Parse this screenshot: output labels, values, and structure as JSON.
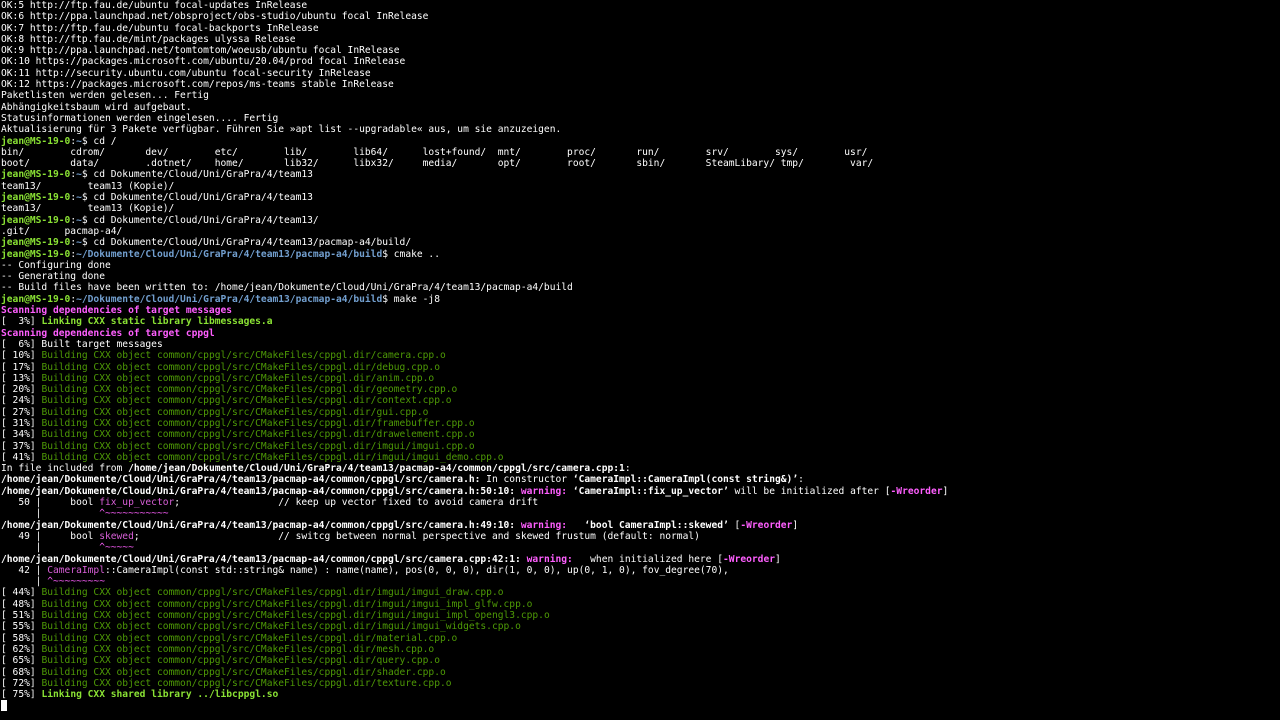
{
  "terminal": {
    "lines": [
      [
        {
          "t": "OK:5 http://ftp.fau.de/ubuntu focal-updates InRelease",
          "c": ""
        }
      ],
      [
        {
          "t": "OK:6 http://ppa.launchpad.net/obsproject/obs-studio/ubuntu focal InRelease",
          "c": ""
        }
      ],
      [
        {
          "t": "OK:7 http://ftp.fau.de/ubuntu focal-backports InRelease",
          "c": ""
        }
      ],
      [
        {
          "t": "OK:8 http://ftp.fau.de/mint/packages ulyssa Release",
          "c": ""
        }
      ],
      [
        {
          "t": "OK:9 http://ppa.launchpad.net/tomtomtom/woeusb/ubuntu focal InRelease",
          "c": ""
        }
      ],
      [
        {
          "t": "OK:10 https://packages.microsoft.com/ubuntu/20.04/prod focal InRelease",
          "c": ""
        }
      ],
      [
        {
          "t": "OK:11 http://security.ubuntu.com/ubuntu focal-security InRelease",
          "c": ""
        }
      ],
      [
        {
          "t": "OK:12 https://packages.microsoft.com/repos/ms-teams stable InRelease",
          "c": ""
        }
      ],
      [
        {
          "t": "Paketlisten werden gelesen... Fertig",
          "c": ""
        }
      ],
      [
        {
          "t": "Abhängigkeitsbaum wird aufgebaut.",
          "c": ""
        }
      ],
      [
        {
          "t": "Statusinformationen werden eingelesen.... Fertig",
          "c": ""
        }
      ],
      [
        {
          "t": "Aktualisierung für 3 Pakete verfügbar. Führen Sie »apt list --upgradable« aus, um sie anzuzeigen.",
          "c": ""
        }
      ],
      [
        {
          "t": "jean@MS-19-0",
          "c": "p-green"
        },
        {
          "t": ":",
          "c": ""
        },
        {
          "t": "~",
          "c": "p-blue"
        },
        {
          "t": "$ cd /",
          "c": ""
        }
      ],
      [
        {
          "t": "bin/        cdrom/       dev/        etc/        lib/        lib64/      lost+found/  mnt/        proc/       run/        srv/        sys/        usr/",
          "c": ""
        }
      ],
      [
        {
          "t": "boot/       data/        .dotnet/    home/       lib32/      libx32/     media/       opt/        root/       sbin/       SteamLibary/ tmp/        var/",
          "c": ""
        }
      ],
      [
        {
          "t": "jean@MS-19-0",
          "c": "p-green"
        },
        {
          "t": ":",
          "c": ""
        },
        {
          "t": "~",
          "c": "p-blue"
        },
        {
          "t": "$ cd Dokumente/Cloud/Uni/GraPra/4/team13",
          "c": ""
        }
      ],
      [
        {
          "t": "team13/        team13 (Kopie)/",
          "c": ""
        }
      ],
      [
        {
          "t": "jean@MS-19-0",
          "c": "p-green"
        },
        {
          "t": ":",
          "c": ""
        },
        {
          "t": "~",
          "c": "p-blue"
        },
        {
          "t": "$ cd Dokumente/Cloud/Uni/GraPra/4/team13",
          "c": ""
        }
      ],
      [
        {
          "t": "team13/        team13 (Kopie)/",
          "c": ""
        }
      ],
      [
        {
          "t": "jean@MS-19-0",
          "c": "p-green"
        },
        {
          "t": ":",
          "c": ""
        },
        {
          "t": "~",
          "c": "p-blue"
        },
        {
          "t": "$ cd Dokumente/Cloud/Uni/GraPra/4/team13/",
          "c": ""
        }
      ],
      [
        {
          "t": ".git/      pacmap-a4/",
          "c": ""
        }
      ],
      [
        {
          "t": "jean@MS-19-0",
          "c": "p-green"
        },
        {
          "t": ":",
          "c": ""
        },
        {
          "t": "~",
          "c": "p-blue"
        },
        {
          "t": "$ cd Dokumente/Cloud/Uni/GraPra/4/team13/pacmap-a4/build/",
          "c": ""
        }
      ],
      [
        {
          "t": "jean@MS-19-0",
          "c": "p-green"
        },
        {
          "t": ":",
          "c": ""
        },
        {
          "t": "~/Dokumente/Cloud/Uni/GraPra/4/team13/pacmap-a4/build",
          "c": "p-blue"
        },
        {
          "t": "$ cmake ..",
          "c": ""
        }
      ],
      [
        {
          "t": "-- Configuring done",
          "c": ""
        }
      ],
      [
        {
          "t": "-- Generating done",
          "c": ""
        }
      ],
      [
        {
          "t": "-- Build files have been written to: /home/jean/Dokumente/Cloud/Uni/GraPra/4/team13/pacmap-a4/build",
          "c": ""
        }
      ],
      [
        {
          "t": "jean@MS-19-0",
          "c": "p-green"
        },
        {
          "t": ":",
          "c": ""
        },
        {
          "t": "~/Dokumente/Cloud/Uni/GraPra/4/team13/pacmap-a4/build",
          "c": "p-blue"
        },
        {
          "t": "$ make -j8",
          "c": ""
        }
      ],
      [
        {
          "t": "Scanning dependencies of target messages",
          "c": "c-magenta"
        }
      ],
      [
        {
          "t": "[  3%] ",
          "c": ""
        },
        {
          "t": "Linking CXX static library libmessages.a",
          "c": "c-bgreen"
        }
      ],
      [
        {
          "t": "Scanning dependencies of target cppgl",
          "c": "c-magenta"
        }
      ],
      [
        {
          "t": "[  6%] Built target messages",
          "c": ""
        }
      ],
      [
        {
          "t": "[ 10%] ",
          "c": ""
        },
        {
          "t": "Building CXX object common/cppgl/src/CMakeFiles/cppgl.dir/camera.cpp.o",
          "c": "c-green"
        }
      ],
      [
        {
          "t": "[ 17%] ",
          "c": ""
        },
        {
          "t": "Building CXX object common/cppgl/src/CMakeFiles/cppgl.dir/debug.cpp.o",
          "c": "c-green"
        }
      ],
      [
        {
          "t": "[ 13%] ",
          "c": ""
        },
        {
          "t": "Building CXX object common/cppgl/src/CMakeFiles/cppgl.dir/anim.cpp.o",
          "c": "c-green"
        }
      ],
      [
        {
          "t": "[ 20%] ",
          "c": ""
        },
        {
          "t": "Building CXX object common/cppgl/src/CMakeFiles/cppgl.dir/geometry.cpp.o",
          "c": "c-green"
        }
      ],
      [
        {
          "t": "[ 24%] ",
          "c": ""
        },
        {
          "t": "Building CXX object common/cppgl/src/CMakeFiles/cppgl.dir/context.cpp.o",
          "c": "c-green"
        }
      ],
      [
        {
          "t": "[ 27%] ",
          "c": ""
        },
        {
          "t": "Building CXX object common/cppgl/src/CMakeFiles/cppgl.dir/gui.cpp.o",
          "c": "c-green"
        }
      ],
      [
        {
          "t": "[ 31%] ",
          "c": ""
        },
        {
          "t": "Building CXX object common/cppgl/src/CMakeFiles/cppgl.dir/framebuffer.cpp.o",
          "c": "c-green"
        }
      ],
      [
        {
          "t": "[ 34%] ",
          "c": ""
        },
        {
          "t": "Building CXX object common/cppgl/src/CMakeFiles/cppgl.dir/drawelement.cpp.o",
          "c": "c-green"
        }
      ],
      [
        {
          "t": "[ 37%] ",
          "c": ""
        },
        {
          "t": "Building CXX object common/cppgl/src/CMakeFiles/cppgl.dir/imgui/imgui.cpp.o",
          "c": "c-green"
        }
      ],
      [
        {
          "t": "[ 41%] ",
          "c": ""
        },
        {
          "t": "Building CXX object common/cppgl/src/CMakeFiles/cppgl.dir/imgui/imgui_demo.cpp.o",
          "c": "c-green"
        }
      ],
      [
        {
          "t": "In file included from ",
          "c": ""
        },
        {
          "t": "/home/jean/Dokumente/Cloud/Uni/GraPra/4/team13/pacmap-a4/common/cppgl/src/camera.cpp:1",
          "c": "c-white-b"
        },
        {
          "t": ":",
          "c": ""
        }
      ],
      [
        {
          "t": "/home/jean/Dokumente/Cloud/Uni/GraPra/4/team13/pacmap-a4/common/cppgl/src/camera.h:",
          "c": "c-white-b"
        },
        {
          "t": " In constructor ",
          "c": ""
        },
        {
          "t": "‘CameraImpl::CameraImpl(const string&)’",
          "c": "c-white-b"
        },
        {
          "t": ":",
          "c": ""
        }
      ],
      [
        {
          "t": "/home/jean/Dokumente/Cloud/Uni/GraPra/4/team13/pacmap-a4/common/cppgl/src/camera.h:50:10:",
          "c": "c-white-b"
        },
        {
          "t": " warning: ",
          "c": "c-bmag"
        },
        {
          "t": "‘CameraImpl::fix_up_vector’",
          "c": "c-white-b"
        },
        {
          "t": " will be initialized after [",
          "c": ""
        },
        {
          "t": "-Wreorder",
          "c": "c-bmag"
        },
        {
          "t": "]",
          "c": ""
        }
      ],
      [
        {
          "t": "   50 |     bool ",
          "c": ""
        },
        {
          "t": "fix_up_vector",
          "c": "c-magenta-n"
        },
        {
          "t": ";                 // keep up vector fixed to avoid camera drift",
          "c": ""
        }
      ],
      [
        {
          "t": "      |          ",
          "c": ""
        },
        {
          "t": "^~~~~~~~~~~~",
          "c": "c-caret"
        }
      ],
      [
        {
          "t": "/home/jean/Dokumente/Cloud/Uni/GraPra/4/team13/pacmap-a4/common/cppgl/src/camera.h:49:10:",
          "c": "c-white-b"
        },
        {
          "t": " warning: ",
          "c": "c-bmag"
        },
        {
          "t": "  ‘bool CameraImpl::skewed’",
          "c": "c-white-b"
        },
        {
          "t": " [",
          "c": ""
        },
        {
          "t": "-Wreorder",
          "c": "c-bmag"
        },
        {
          "t": "]",
          "c": ""
        }
      ],
      [
        {
          "t": "   49 |     bool ",
          "c": ""
        },
        {
          "t": "skewed",
          "c": "c-magenta-n"
        },
        {
          "t": ";                        // switcg between normal perspective and skewed frustum (default: normal)",
          "c": ""
        }
      ],
      [
        {
          "t": "      |          ",
          "c": ""
        },
        {
          "t": "^~~~~~",
          "c": "c-caret"
        }
      ],
      [
        {
          "t": "/home/jean/Dokumente/Cloud/Uni/GraPra/4/team13/pacmap-a4/common/cppgl/src/camera.cpp:42:1:",
          "c": "c-white-b"
        },
        {
          "t": " warning: ",
          "c": "c-bmag"
        },
        {
          "t": "  when initialized here [",
          "c": ""
        },
        {
          "t": "-Wreorder",
          "c": "c-bmag"
        },
        {
          "t": "]",
          "c": ""
        }
      ],
      [
        {
          "t": "   42 | ",
          "c": ""
        },
        {
          "t": "CameraImpl",
          "c": "c-magenta-n"
        },
        {
          "t": "::CameraImpl(const std::string& name) : name(name), pos(0, 0, 0), dir(1, 0, 0), up(0, 1, 0), fov_degree(70),",
          "c": ""
        }
      ],
      [
        {
          "t": "      | ",
          "c": ""
        },
        {
          "t": "^~~~~~~~~~",
          "c": "c-caret"
        }
      ],
      [
        {
          "t": "[ 44%] ",
          "c": ""
        },
        {
          "t": "Building CXX object common/cppgl/src/CMakeFiles/cppgl.dir/imgui/imgui_draw.cpp.o",
          "c": "c-green"
        }
      ],
      [
        {
          "t": "[ 48%] ",
          "c": ""
        },
        {
          "t": "Building CXX object common/cppgl/src/CMakeFiles/cppgl.dir/imgui/imgui_impl_glfw.cpp.o",
          "c": "c-green"
        }
      ],
      [
        {
          "t": "[ 51%] ",
          "c": ""
        },
        {
          "t": "Building CXX object common/cppgl/src/CMakeFiles/cppgl.dir/imgui/imgui_impl_opengl3.cpp.o",
          "c": "c-green"
        }
      ],
      [
        {
          "t": "[ 55%] ",
          "c": ""
        },
        {
          "t": "Building CXX object common/cppgl/src/CMakeFiles/cppgl.dir/imgui/imgui_widgets.cpp.o",
          "c": "c-green"
        }
      ],
      [
        {
          "t": "[ 58%] ",
          "c": ""
        },
        {
          "t": "Building CXX object common/cppgl/src/CMakeFiles/cppgl.dir/material.cpp.o",
          "c": "c-green"
        }
      ],
      [
        {
          "t": "[ 62%] ",
          "c": ""
        },
        {
          "t": "Building CXX object common/cppgl/src/CMakeFiles/cppgl.dir/mesh.cpp.o",
          "c": "c-green"
        }
      ],
      [
        {
          "t": "[ 65%] ",
          "c": ""
        },
        {
          "t": "Building CXX object common/cppgl/src/CMakeFiles/cppgl.dir/query.cpp.o",
          "c": "c-green"
        }
      ],
      [
        {
          "t": "[ 68%] ",
          "c": ""
        },
        {
          "t": "Building CXX object common/cppgl/src/CMakeFiles/cppgl.dir/shader.cpp.o",
          "c": "c-green"
        }
      ],
      [
        {
          "t": "[ 72%] ",
          "c": ""
        },
        {
          "t": "Building CXX object common/cppgl/src/CMakeFiles/cppgl.dir/texture.cpp.o",
          "c": "c-green"
        }
      ],
      [
        {
          "t": "[ 75%] ",
          "c": ""
        },
        {
          "t": "Linking CXX shared library ../libcppgl.so",
          "c": "c-bgreen"
        }
      ]
    ]
  }
}
